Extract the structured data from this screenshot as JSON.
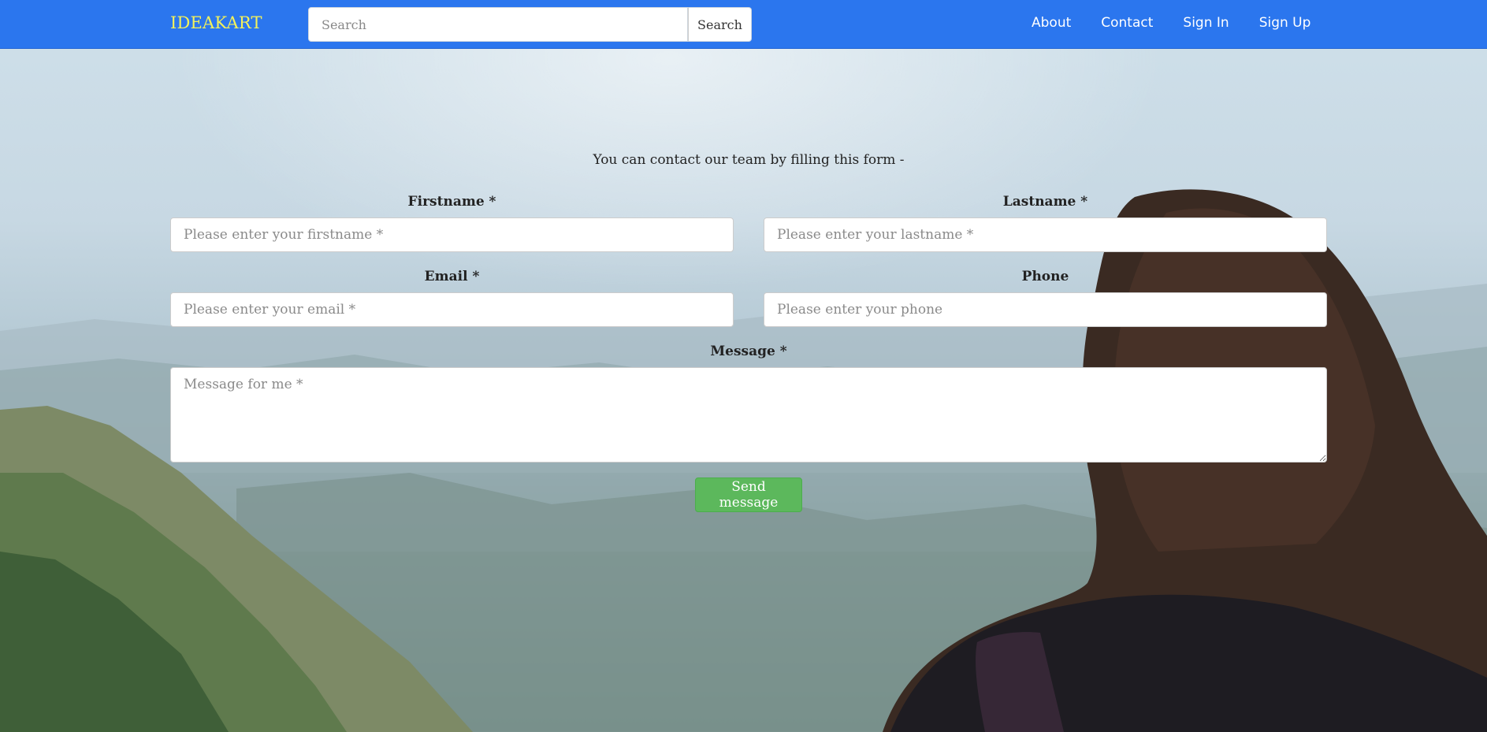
{
  "navbar": {
    "brand": "IDEAKART",
    "search_placeholder": "Search",
    "search_button": "Search",
    "links": [
      "About",
      "Contact",
      "Sign In",
      "Sign Up"
    ]
  },
  "contact": {
    "intro": "You can contact our team by filling this form -",
    "firstname_label": "Firstname *",
    "firstname_placeholder": "Please enter your firstname *",
    "lastname_label": "Lastname *",
    "lastname_placeholder": "Please enter your lastname *",
    "email_label": "Email *",
    "email_placeholder": "Please enter your email *",
    "phone_label": "Phone",
    "phone_placeholder": "Please enter your phone",
    "message_label": "Message *",
    "message_placeholder": "Message for me *",
    "send_button": "Send message"
  },
  "colors": {
    "navbar": "#2b76ee",
    "brand": "#f4f25a",
    "send_button": "#5cb85c"
  }
}
